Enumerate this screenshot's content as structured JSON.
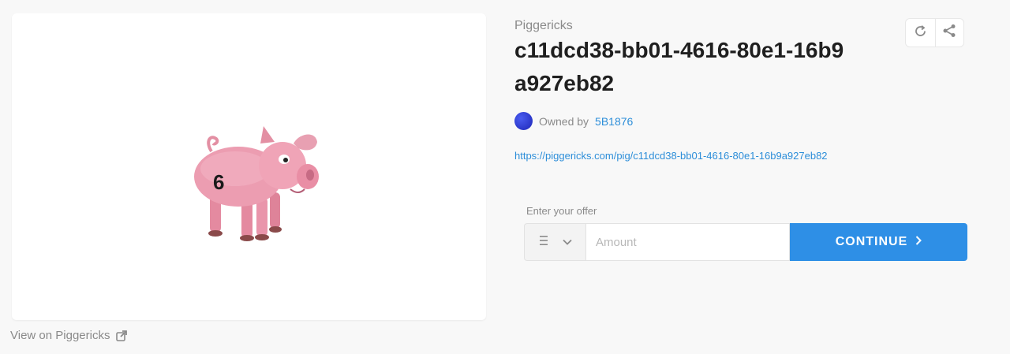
{
  "image_card": {
    "pig_number": "6",
    "view_link_label": "View on Piggericks",
    "view_link_icon": "external-link-icon"
  },
  "details": {
    "collection": "Piggericks",
    "title": "c11dcd38-bb01-4616-80e1-16b9a927eb82",
    "owner_prefix": "Owned by",
    "owner_name": "5B1876",
    "url": "https://piggericks.com/pig/c11dcd38-bb01-4616-80e1-16b9a927eb82",
    "actions": [
      "refresh-icon",
      "share-icon"
    ]
  },
  "offer": {
    "label": "Enter your offer",
    "currency_icon": "ethereum-icon",
    "amount_placeholder": "Amount",
    "amount_value": "",
    "continue_label": "CONTINUE"
  },
  "colors": {
    "accent": "#2e8fe6",
    "link": "#2d8ed9",
    "avatar": "#3a48e0",
    "background": "#f8f8f8"
  }
}
